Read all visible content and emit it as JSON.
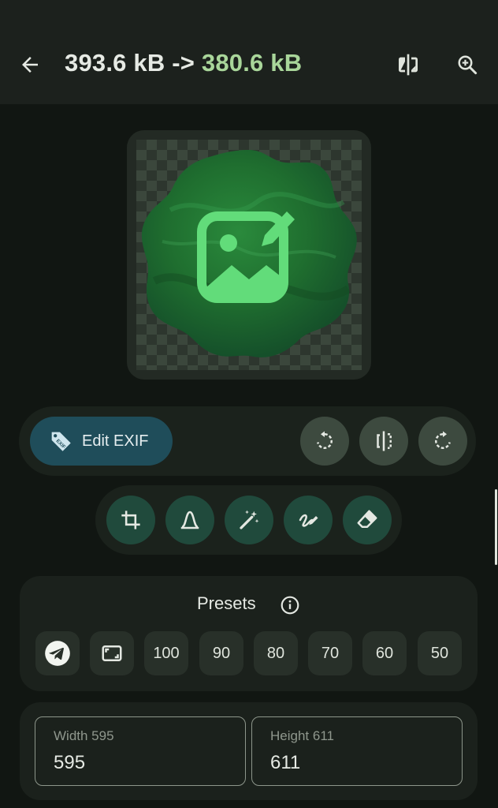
{
  "header": {
    "old_size": "393.6 kB",
    "arrow": " -> ",
    "new_size": "380.6 kB",
    "back_icon": "arrow-back-icon",
    "compare_icon": "compare-icon",
    "zoom_icon": "zoom-in-icon"
  },
  "colors": {
    "accent_green": "#a9d69a",
    "exif_button": "#1f4d5a",
    "tool_button": "#204a3c"
  },
  "toolbar": {
    "exif_label": "Edit EXIF",
    "rotate_left_icon": "rotate-left-icon",
    "flip_icon": "flip-icon",
    "rotate_right_icon": "rotate-right-icon"
  },
  "tools": [
    "crop-icon",
    "curves-icon",
    "magic-wand-icon",
    "draw-icon",
    "eraser-icon"
  ],
  "presets": {
    "title": "Presets",
    "values": [
      "100",
      "90",
      "80",
      "70",
      "60",
      "50"
    ]
  },
  "size": {
    "width_label": "Width 595",
    "width_value": "595",
    "height_label": "Height 611",
    "height_value": "611"
  }
}
